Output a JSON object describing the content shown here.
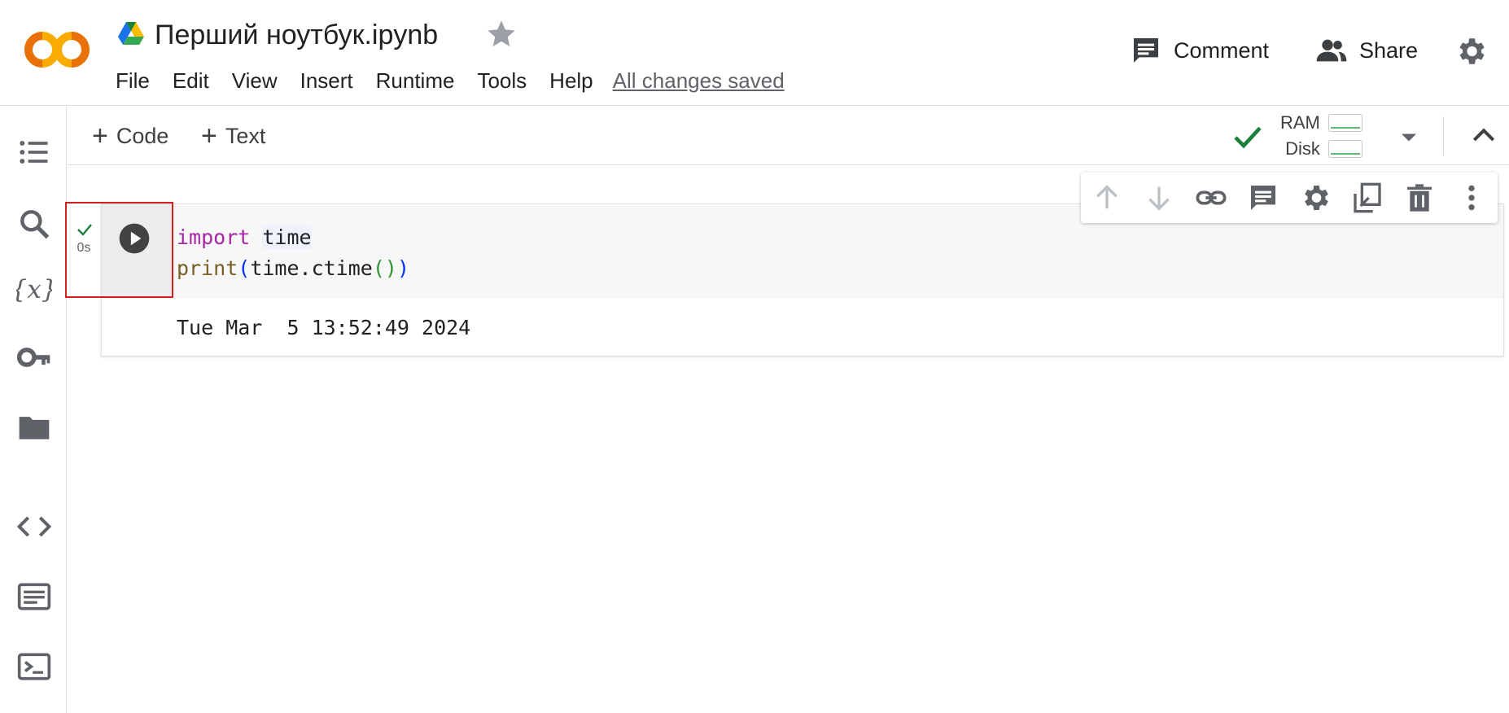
{
  "header": {
    "title": "Перший ноутбук.ipynb",
    "menu": [
      "File",
      "Edit",
      "View",
      "Insert",
      "Runtime",
      "Tools",
      "Help"
    ],
    "save_status": "All changes saved",
    "comment_label": "Comment",
    "share_label": "Share"
  },
  "toolbar": {
    "add_code_label": "Code",
    "add_text_label": "Text",
    "ram_label": "RAM",
    "disk_label": "Disk"
  },
  "cell": {
    "code_line1_kw": "import",
    "code_line1_mod": "time",
    "code_line2_fn": "print",
    "code_line2_mid": "time.ctime",
    "exec_time": "0s",
    "output": "Tue Mar  5 13:52:49 2024"
  },
  "colors": {
    "accent_green": "#188038",
    "highlight_red": "#d61f1f",
    "logo_orange": "#f9ab00",
    "logo_dark_orange": "#e8710a"
  },
  "icons": {
    "sidebar": [
      "toc-icon",
      "search-icon",
      "variables-icon",
      "key-icon",
      "folder-icon",
      "code-snippets-icon",
      "command-palette-icon",
      "terminal-icon"
    ],
    "cell_toolbar": [
      "arrow-up-icon",
      "arrow-down-icon",
      "link-icon",
      "comment-icon",
      "gear-icon",
      "mirror-cell-icon",
      "trash-icon",
      "more-vert-icon"
    ]
  }
}
